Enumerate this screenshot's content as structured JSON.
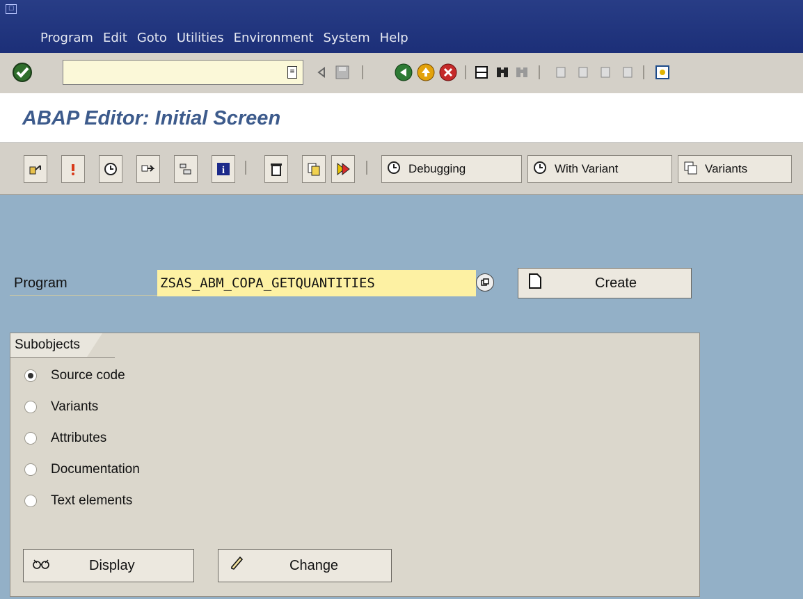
{
  "menubar": {
    "items": [
      {
        "label": "Program"
      },
      {
        "label": "Edit"
      },
      {
        "label": "Goto"
      },
      {
        "label": "Utilities"
      },
      {
        "label": "Environment"
      },
      {
        "label": "System"
      },
      {
        "label": "Help"
      }
    ]
  },
  "toolbar": {
    "command_value": "",
    "icons": [
      "enter-icon",
      "command-history-icon",
      "back-arrow-icon",
      "save-icon",
      "back-icon",
      "exit-icon",
      "cancel-icon",
      "print-icon",
      "find-icon",
      "find-next-icon",
      "first-page-icon",
      "previous-page-icon",
      "next-page-icon",
      "last-page-icon",
      "create-session-icon"
    ]
  },
  "title": "ABAP Editor: Initial Screen",
  "app_toolbar": {
    "icons": [
      "where-used-icon",
      "check-icon",
      "execute-icon",
      "test-icon",
      "other-object-icon",
      "info-icon",
      "delete-icon",
      "copy-icon",
      "rename-icon"
    ],
    "debugging_label": "Debugging",
    "with_variant_label": "With Variant",
    "variants_label": "Variants"
  },
  "form": {
    "program_label": "Program",
    "program_value": "ZSAS_ABM_COPA_GETQUANTITIES",
    "create_label": "Create"
  },
  "subobjects": {
    "title": "Subobjects",
    "options": [
      {
        "label": "Source code",
        "selected": true
      },
      {
        "label": "Variants",
        "selected": false
      },
      {
        "label": "Attributes",
        "selected": false
      },
      {
        "label": "Documentation",
        "selected": false
      },
      {
        "label": "Text elements",
        "selected": false
      }
    ],
    "display_label": "Display",
    "change_label": "Change"
  }
}
